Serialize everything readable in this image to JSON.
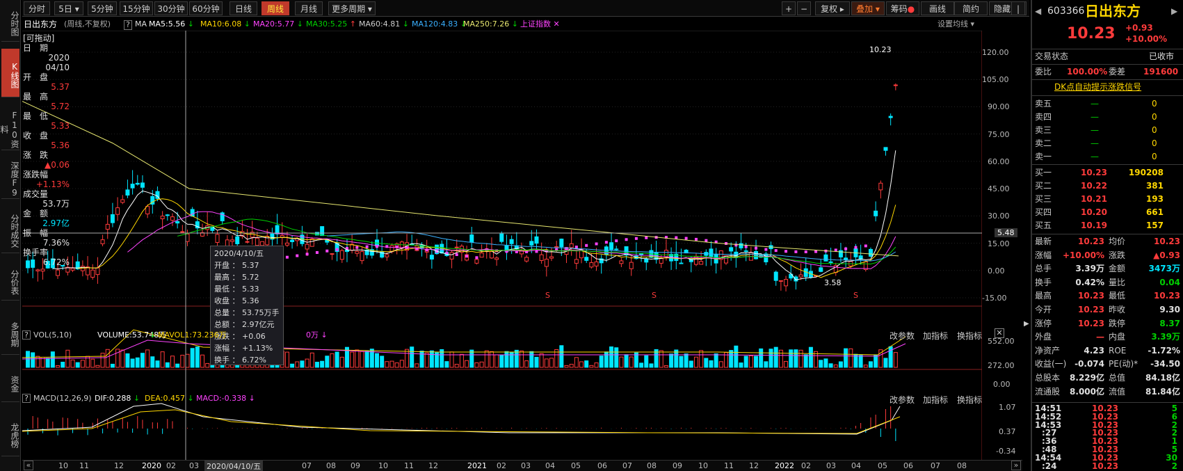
{
  "toolbar": {
    "periods": [
      "分时",
      "5日",
      "5分钟",
      "15分钟",
      "30分钟",
      "60分钟",
      "日线",
      "周线",
      "月线",
      "更多周期"
    ],
    "active_period": "周线",
    "right": [
      "+",
      "−",
      "复权",
      "叠加",
      "筹码",
      "画线",
      "简约",
      "隐藏"
    ],
    "collapse": "|"
  },
  "left_tabs": [
    "分时图",
    "K线图",
    "F10资料",
    "深度F9",
    "分时成交",
    "分价表",
    "多周期",
    "资金",
    "龙虎榜"
  ],
  "info": {
    "name": "日出东方",
    "mode": "(周线,不复权)",
    "ma_label": "MA",
    "ma5": "MA5:5.56",
    "ma10": "MA10:6.08",
    "ma20": "MA20:5.77",
    "ma30": "MA30:5.25",
    "ma60": "MA60:4.81",
    "ma120": "MA120:4.83",
    "ma250": "MA250:7.26",
    "overlay": "上证指数",
    "settings": "设置均线",
    "help": "?"
  },
  "hover_panel": {
    "drag": "[可拖动]",
    "items": [
      {
        "label": "日　期",
        "value": "2020",
        "value2": "04/10",
        "color": "#e0e0e0"
      },
      {
        "label": "开　盘",
        "value": "5.37",
        "color": "#ff3b3b"
      },
      {
        "label": "最　高",
        "value": "5.72",
        "color": "#ff3b3b"
      },
      {
        "label": "最　低",
        "value": "5.33",
        "color": "#ff3b3b"
      },
      {
        "label": "收　盘",
        "value": "5.36",
        "color": "#ff3b3b"
      },
      {
        "label": "涨　跌",
        "value": "▲0.06",
        "color": "#ff3b3b"
      },
      {
        "label": "涨跌幅",
        "value": "+1.13%",
        "color": "#ff3b3b"
      },
      {
        "label": "成交量",
        "value": "53.7万",
        "color": "#e0e0e0"
      },
      {
        "label": "金　额",
        "value": "2.97亿",
        "color": "#00e5ff"
      },
      {
        "label": "振　幅",
        "value": "7.36%",
        "color": "#e0e0e0"
      },
      {
        "label": "换手率",
        "value": "6.72%",
        "color": "#e0e0e0"
      }
    ]
  },
  "tooltip": {
    "date": "2020/4/10/五",
    "rows": [
      "开盘 ： 5.37",
      "最高 ： 5.72",
      "最低 ： 5.33",
      "收盘 ： 5.36",
      "总量 ： 53.75万手",
      "总额 ： 2.97亿元",
      "涨跌 ： +0.06",
      "涨幅 ： +1.13%",
      "换手 ： 6.72%"
    ]
  },
  "price_axis": [
    "120.00",
    "105.00",
    "90.00",
    "75.00",
    "60.00",
    "45.00",
    "30.00",
    "15.00",
    "0.00",
    "-15.00"
  ],
  "crosshair_price": "5.48",
  "price_marks": {
    "high": "10.23",
    "low": "3.58"
  },
  "vol": {
    "name": "VOL(5,10)",
    "volume": "VOLUME:53.748万",
    "mavol1": "MAVOL1:73.236万",
    "tail": "0万",
    "axis": [
      "552.00",
      "272.00",
      "0.00"
    ],
    "buttons": [
      "改参数",
      "加指标",
      "换指标"
    ]
  },
  "macd": {
    "name": "MACD(12,26,9)",
    "dif": "DIF:0.288",
    "dea": "DEA:0.457",
    "macd": "MACD:-0.338",
    "axis": [
      "1.07",
      "0.37",
      "-0.34"
    ],
    "buttons": [
      "改参数",
      "加指标",
      "换指标"
    ]
  },
  "xaxis": {
    "labels": [
      "10",
      "11",
      "12",
      "2020",
      "02",
      "03",
      "06",
      "07",
      "08",
      "09",
      "10",
      "11",
      "12",
      "2021",
      "02",
      "03",
      "04",
      "05",
      "06",
      "07",
      "08",
      "09",
      "10",
      "11",
      "12",
      "2022",
      "02",
      "03",
      "04",
      "05",
      "06",
      "07",
      "08"
    ],
    "cursor": "2020/04/10/五"
  },
  "quote": {
    "code": "603366",
    "name": "日出东方",
    "price": "10.23",
    "change": "+0.93",
    "pct": "+10.00%",
    "status_label": "交易状态",
    "status": "已收市",
    "weibi_label": "委比",
    "weibi": "100.00%",
    "weicha_label": "委差",
    "weicha": "191600",
    "link": "DK点自动提示涨跌信号",
    "sells": [
      {
        "label": "卖五",
        "price": "—",
        "vol": "0"
      },
      {
        "label": "卖四",
        "price": "—",
        "vol": "0"
      },
      {
        "label": "卖三",
        "price": "—",
        "vol": "0"
      },
      {
        "label": "卖二",
        "price": "—",
        "vol": "0"
      },
      {
        "label": "卖一",
        "price": "—",
        "vol": "0"
      }
    ],
    "buys": [
      {
        "label": "买一",
        "price": "10.23",
        "vol": "190208"
      },
      {
        "label": "买二",
        "price": "10.22",
        "vol": "381"
      },
      {
        "label": "买三",
        "price": "10.21",
        "vol": "193"
      },
      {
        "label": "买四",
        "price": "10.20",
        "vol": "661"
      },
      {
        "label": "买五",
        "price": "10.19",
        "vol": "157"
      }
    ],
    "stats": [
      {
        "l1": "最新",
        "v1": "10.23",
        "c1": "#ff3b3b",
        "l2": "均价",
        "v2": "10.23",
        "c2": "#ff3b3b"
      },
      {
        "l1": "涨幅",
        "v1": "+10.00%",
        "c1": "#ff3b3b",
        "l2": "涨跌",
        "v2": "▲0.93",
        "c2": "#ff3b3b"
      },
      {
        "l1": "总手",
        "v1": "3.39万",
        "c1": "#e0e0e0",
        "l2": "金额",
        "v2": "3473万",
        "c2": "#00e5ff"
      },
      {
        "l1": "换手",
        "v1": "0.42%",
        "c1": "#e0e0e0",
        "l2": "量比",
        "v2": "0.04",
        "c2": "#00d000"
      },
      {
        "l1": "最高",
        "v1": "10.23",
        "c1": "#ff3b3b",
        "l2": "最低",
        "v2": "10.23",
        "c2": "#ff3b3b"
      },
      {
        "l1": "今开",
        "v1": "10.23",
        "c1": "#ff3b3b",
        "l2": "昨收",
        "v2": "9.30",
        "c2": "#e0e0e0"
      },
      {
        "l1": "涨停",
        "v1": "10.23",
        "c1": "#ff3b3b",
        "l2": "跌停",
        "v2": "8.37",
        "c2": "#00d000"
      },
      {
        "l1": "外盘",
        "v1": "—",
        "c1": "#ff3b3b",
        "l2": "内盘",
        "v2": "3.39万",
        "c2": "#00d000"
      },
      {
        "l1": "净资产",
        "v1": "4.23",
        "c1": "#e0e0e0",
        "l2": "ROE",
        "v2": "-1.72%",
        "c2": "#e0e0e0"
      },
      {
        "l1": "收益(一)",
        "v1": "-0.074",
        "c1": "#e0e0e0",
        "l2": "PE(动)*",
        "v2": "-34.50",
        "c2": "#e0e0e0"
      },
      {
        "l1": "总股本",
        "v1": "8.229亿",
        "c1": "#e0e0e0",
        "l2": "总值",
        "v2": "84.18亿",
        "c2": "#e0e0e0"
      },
      {
        "l1": "流通股",
        "v1": "8.000亿",
        "c1": "#e0e0e0",
        "l2": "流值",
        "v2": "81.84亿",
        "c2": "#e0e0e0"
      }
    ],
    "ticks": [
      {
        "t": "14:51",
        "p": "10.23",
        "v": "5"
      },
      {
        "t": "14:52",
        "p": "10.23",
        "v": "6"
      },
      {
        "t": "14:53",
        "p": "10.23",
        "v": "2"
      },
      {
        "t": ":27",
        "p": "10.23",
        "v": "2"
      },
      {
        "t": ":36",
        "p": "10.23",
        "v": "1"
      },
      {
        "t": ":48",
        "p": "10.23",
        "v": "5"
      },
      {
        "t": "14:54",
        "p": "10.23",
        "v": "30"
      },
      {
        "t": ":24",
        "p": "10.23",
        "v": "2"
      }
    ]
  },
  "colors": {
    "up": "#ff3b3b",
    "down": "#00e5ff",
    "ma5": "#ffffff",
    "ma10": "#ffd700",
    "ma20": "#ff44ff",
    "ma30": "#00d000",
    "ma60": "#aaaaaa",
    "ma120": "#3ab0ff",
    "ma250": "#e8e870"
  }
}
